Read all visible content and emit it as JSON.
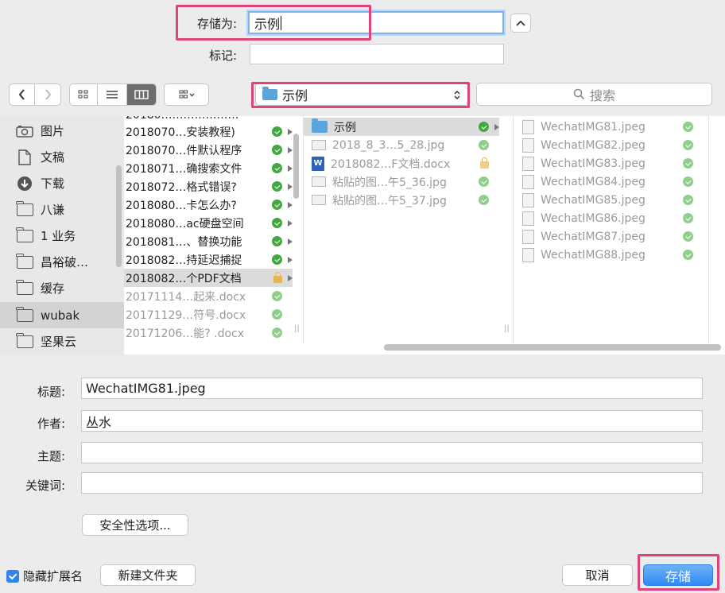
{
  "save_as": {
    "label": "存储为:",
    "value": "示例"
  },
  "tags": {
    "label": "标记:",
    "value": ""
  },
  "toolbar": {
    "location": "示例",
    "search_placeholder": "搜索"
  },
  "sidebar": {
    "items": [
      {
        "label": "图片",
        "icon": "camera-icon"
      },
      {
        "label": "文稿",
        "icon": "document-icon"
      },
      {
        "label": "下载",
        "icon": "download-icon"
      },
      {
        "label": "八谦",
        "icon": "folder-icon"
      },
      {
        "label": "1 业务",
        "icon": "folder-icon"
      },
      {
        "label": "昌裕破…",
        "icon": "folder-icon"
      },
      {
        "label": "缓存",
        "icon": "folder-icon"
      },
      {
        "label": "wubak",
        "icon": "folder-icon"
      },
      {
        "label": "坚果云",
        "icon": "folder-icon"
      }
    ]
  },
  "column1": [
    "2018070…安装教程)",
    "2018070…件默认程序",
    "2018071…确搜索文件",
    "2018072…格式错误?",
    "2018080…卡怎么办?",
    "2018080…ac硬盘空间",
    "2018081…、替换功能",
    "2018082…持延迟捕捉",
    "2018082…个PDF文档",
    "20171114…起来.docx",
    "20171129…符号.docx",
    "20171206…能? .docx"
  ],
  "column2": [
    {
      "name": "示例",
      "type": "folder"
    },
    {
      "name": "2018_8_3…5_28.jpg",
      "type": "image"
    },
    {
      "name": "2018082…F文档.docx",
      "type": "word"
    },
    {
      "name": "粘贴的图…午5_36.jpg",
      "type": "image"
    },
    {
      "name": "粘贴的图…午5_37.jpg",
      "type": "image"
    }
  ],
  "column3": [
    "WechatIMG81.jpeg",
    "WechatIMG82.jpeg",
    "WechatIMG83.jpeg",
    "WechatIMG84.jpeg",
    "WechatIMG85.jpeg",
    "WechatIMG86.jpeg",
    "WechatIMG87.jpeg",
    "WechatIMG88.jpeg"
  ],
  "form": {
    "title_label": "标题:",
    "title_value": "WechatIMG81.jpeg",
    "author_label": "作者:",
    "author_value": "丛水",
    "subject_label": "主题:",
    "subject_value": "",
    "keywords_label": "关键词:",
    "keywords_value": "",
    "security_button": "安全性选项..."
  },
  "footer": {
    "hide_extension": "隐藏扩展名",
    "new_folder": "新建文件夹",
    "cancel": "取消",
    "save": "存储"
  },
  "colors": {
    "accent": "#2f8af5",
    "highlight": "#e0427a",
    "check": "#43a640"
  }
}
